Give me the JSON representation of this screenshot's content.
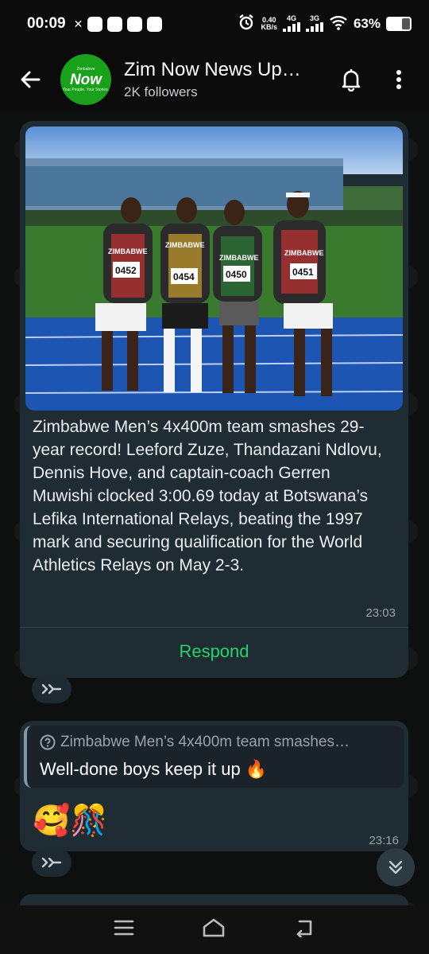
{
  "status_bar": {
    "time": "00:09",
    "net_speed_value": "0.40",
    "net_speed_unit": "KB/s",
    "signal1": "4G",
    "signal2": "3G",
    "battery": "63%",
    "battery_level": 0.63
  },
  "header": {
    "channel_name": "Zim Now News Up…",
    "followers": "2K followers",
    "avatar_text": "Now",
    "avatar_small": "Zimbabwe",
    "avatar_tagline": "Your People. Your Stories."
  },
  "messages": [
    {
      "text": "Zimbabwe Men’s 4x400m team smashes 29-year record! Leeford Zuze, Thandazani Ndlovu, Dennis Hove, and captain-coach Gerren Muwishi clocked 3:00.69 today at Botswana’s Lefika International Relays, beating the 1997 mark and securing qualification for the World Athletics Relays on May 2-3.",
      "time": "23:03",
      "respond_label": "Respond",
      "photo_bibs": [
        "0452",
        "0454",
        "0450",
        "0451"
      ],
      "jersey_text": "ZIMBABWE"
    },
    {
      "quote": "Zimbabwe Men’s 4x400m team smashes…",
      "text": "Well-done boys keep it up 🔥",
      "emojis": "🥰🎊",
      "time": "23:16"
    }
  ],
  "colors": {
    "accent": "#25d366",
    "bubble": "#202c33",
    "avatar_bg": "#19a11c"
  }
}
